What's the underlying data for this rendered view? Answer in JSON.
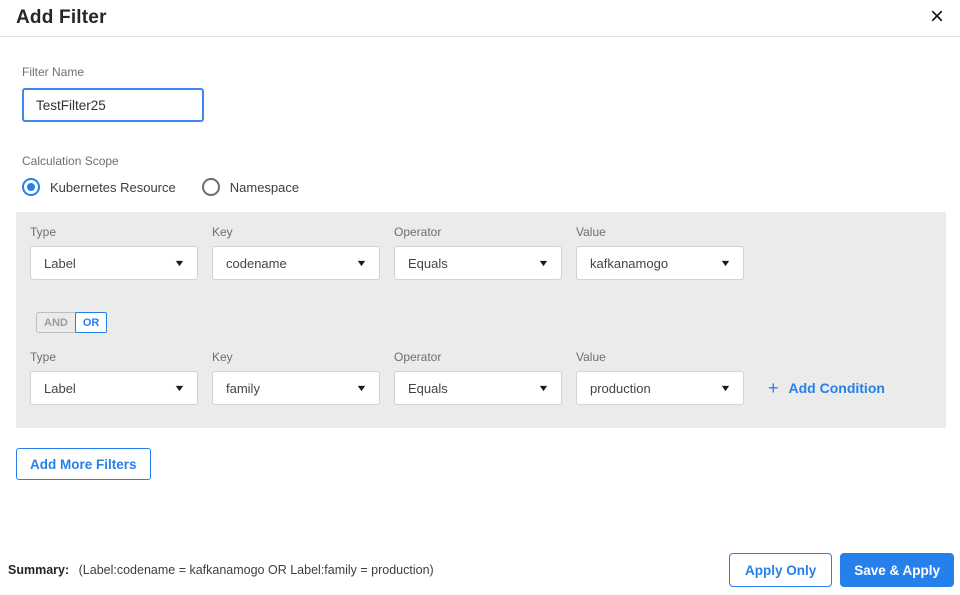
{
  "dialog": {
    "title": "Add Filter"
  },
  "icons": {
    "close": "×",
    "dropdown": "▼",
    "plus": "+"
  },
  "filter_name": {
    "label": "Filter Name",
    "value": "TestFilter25"
  },
  "calculation_scope": {
    "label": "Calculation Scope",
    "options": [
      {
        "label": "Kubernetes Resource",
        "selected": true
      },
      {
        "label": "Namespace",
        "selected": false
      }
    ]
  },
  "conditions": {
    "column_labels": {
      "type": "Type",
      "key": "Key",
      "operator": "Operator",
      "value": "Value"
    },
    "logic": {
      "and_label": "AND",
      "or_label": "OR",
      "selected": "OR"
    },
    "rows": [
      {
        "type": "Label",
        "key": "codename",
        "operator": "Equals",
        "value": "kafkanamogo"
      },
      {
        "type": "Label",
        "key": "family",
        "operator": "Equals",
        "value": "production"
      }
    ],
    "add_condition_label": "Add Condition"
  },
  "buttons": {
    "add_more_filters": "Add More Filters",
    "apply_only": "Apply Only",
    "save_and_apply": "Save & Apply"
  },
  "footer": {
    "summary_label": "Summary:",
    "summary_text": "(Label:codename = kafkanamogo OR Label:family = production)"
  },
  "colors": {
    "accent": "#2680eb",
    "focus_border": "#4285f4",
    "panel_bg": "#ebebeb"
  }
}
